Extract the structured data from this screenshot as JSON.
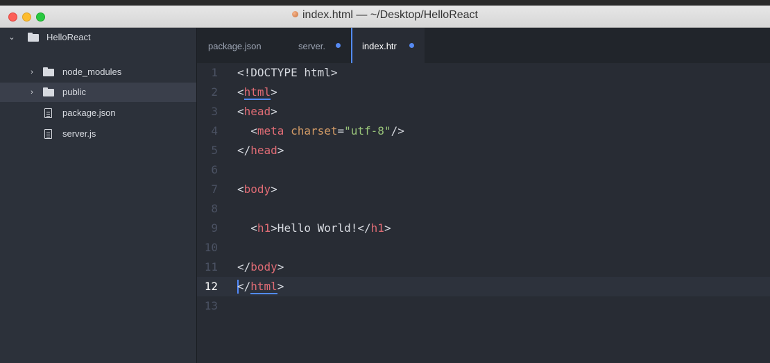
{
  "window": {
    "title": "index.html — ~/Desktop/HelloReact"
  },
  "sidebar": {
    "project": "HelloReact",
    "items": [
      {
        "label": "node_modules",
        "type": "folder"
      },
      {
        "label": "public",
        "type": "folder"
      },
      {
        "label": "package.json",
        "type": "file"
      },
      {
        "label": "server.js",
        "type": "file"
      }
    ]
  },
  "tabs": [
    {
      "label": "package.json",
      "modified": false
    },
    {
      "label": "server.",
      "modified": true
    },
    {
      "label": "index.htr",
      "modified": true,
      "active": true
    }
  ],
  "editor": {
    "current_line": 12,
    "line_numbers": [
      "1",
      "2",
      "3",
      "4",
      "5",
      "6",
      "7",
      "8",
      "9",
      "10",
      "11",
      "12",
      "13"
    ],
    "lines": [
      {
        "open": "<!DOCTYPE html>"
      },
      {
        "open": "<",
        "tag": "html",
        "close": ">"
      },
      {
        "open": "<",
        "tag": "head",
        "close": ">"
      },
      {
        "indent": "  ",
        "open": "<",
        "tag": "meta",
        "attr": " charset",
        "eq": "=",
        "value": "\"utf-8\"",
        "close": "/>"
      },
      {
        "open": "</",
        "tag": "head",
        "close": ">"
      },
      {},
      {
        "open": "<",
        "tag": "body",
        "close": ">"
      },
      {},
      {
        "indent": "  ",
        "open": "<",
        "tag": "h1",
        "mid": ">Hello World!</",
        "tag2": "h1",
        "close": ">"
      },
      {},
      {
        "open": "</",
        "tag": "body",
        "close": ">"
      },
      {
        "open": "</",
        "tag": "html",
        "close": ">"
      },
      {}
    ]
  },
  "colors": {
    "tag": "#e06c75",
    "attr": "#d19a66",
    "string": "#98c379",
    "accent": "#528bff"
  }
}
